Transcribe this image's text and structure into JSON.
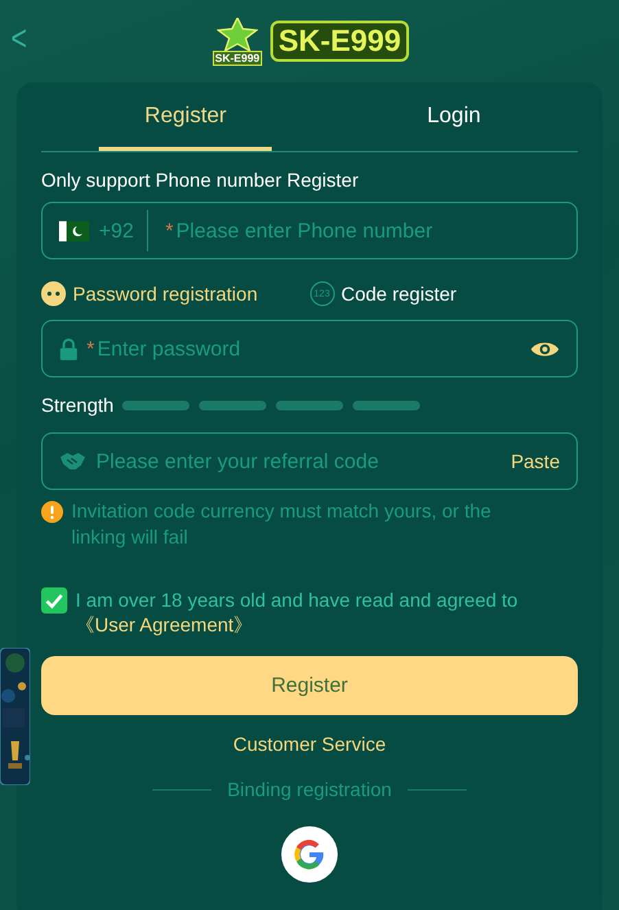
{
  "header": {
    "back": "<",
    "logo": {
      "emblem_text": "SK-E999",
      "text": "SK-E999"
    }
  },
  "tabs": [
    {
      "label": "Register",
      "selected": true
    },
    {
      "label": "Login",
      "selected": false
    }
  ],
  "phone": {
    "label": "Only support Phone number Register",
    "code": "+92",
    "required_mark": "*",
    "placeholder": "Please enter Phone number"
  },
  "methods": [
    {
      "kind": "password",
      "label": "Password registration",
      "selected": true
    },
    {
      "kind": "code",
      "label": "Code register",
      "icon_text": "123",
      "selected": false
    }
  ],
  "password": {
    "required_mark": "*",
    "placeholder": "Enter password"
  },
  "strength": {
    "label": "Strength"
  },
  "referral": {
    "placeholder": "Please enter your referral code",
    "paste": "Paste"
  },
  "warning": "Invitation code currency must match yours, or the linking will fail",
  "agreement": {
    "checked": true,
    "text": "I am over 18 years old and have read and agreed to",
    "link": "《User Agreement》"
  },
  "register_button": "Register",
  "customer_service": "Customer Service",
  "binding": "Binding registration"
}
